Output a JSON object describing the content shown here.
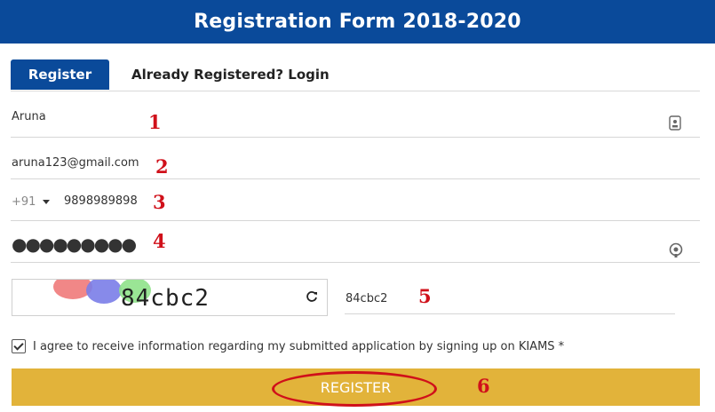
{
  "header": {
    "title": "Registration Form 2018-2020"
  },
  "tabs": {
    "register": "Register",
    "login": "Already Registered? Login"
  },
  "form": {
    "name": "Aruna",
    "email": "aruna123@gmail.com",
    "country_code": "+91",
    "phone": "9898989898",
    "password": "●●●●●●●●●",
    "captcha_text": "84cbc2",
    "captcha_input": "84cbc2",
    "agree_text": "I agree to receive information regarding my submitted application by signing up on KIAMS *",
    "register_button": "REGISTER"
  },
  "annotations": [
    "1",
    "2",
    "3",
    "4",
    "5",
    "6"
  ],
  "icons": {
    "name": "id-card-icon",
    "password": "eye-icon",
    "refresh": "refresh-icon",
    "dropdown": "caret-down-icon",
    "checkbox": "checkbox-checked-icon"
  },
  "colors": {
    "primary": "#0a4a9a",
    "button": "#e2b33a",
    "annotation": "#d0101a"
  }
}
